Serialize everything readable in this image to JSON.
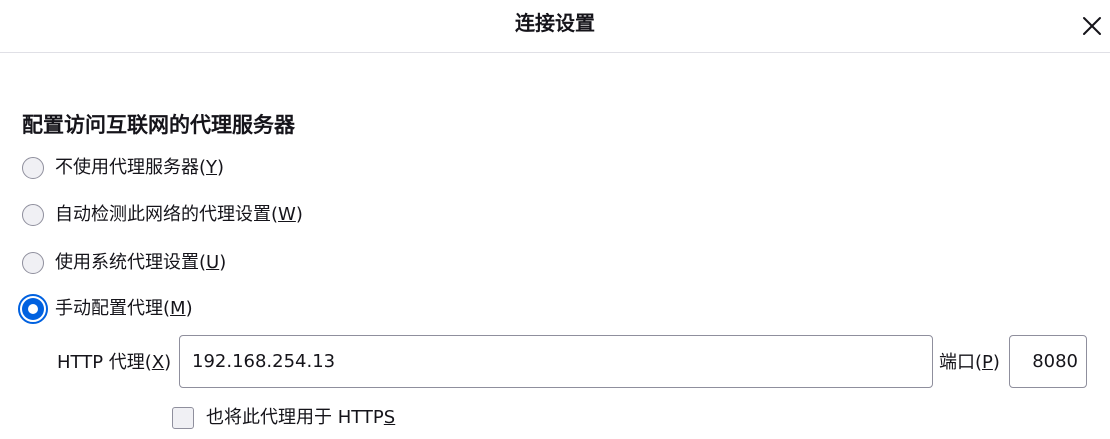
{
  "dialog": {
    "title": "连接设置",
    "close_icon": "close-icon"
  },
  "section": {
    "title": "配置访问互联网的代理服务器"
  },
  "proxy_options": [
    {
      "label": "不使用代理服务器",
      "key_open": "(",
      "key": "Y",
      "key_close": ")",
      "selected": false
    },
    {
      "label": "自动检测此网络的代理设置",
      "key_open": "(",
      "key": "W",
      "key_close": ")",
      "selected": false
    },
    {
      "label": "使用系统代理设置",
      "key_open": "(",
      "key": "U",
      "key_close": ")",
      "selected": false
    },
    {
      "label": "手动配置代理",
      "key_open": "(",
      "key": "M",
      "key_close": ")",
      "selected": true
    }
  ],
  "manual": {
    "http_label": "HTTP 代理",
    "http_key": "X",
    "http_value": "192.168.254.13",
    "port_label": "端口",
    "port_key": "P",
    "port_value": "8080",
    "https_label_prefix": "也将此代理用于 HTTP",
    "https_label_key": "S",
    "https_checked": false
  },
  "colors": {
    "accent": "#0061e0",
    "text": "#15141a",
    "border": "#8f8f9d",
    "control_bg": "#f0f0f4",
    "divider": "#e0e0e6"
  }
}
